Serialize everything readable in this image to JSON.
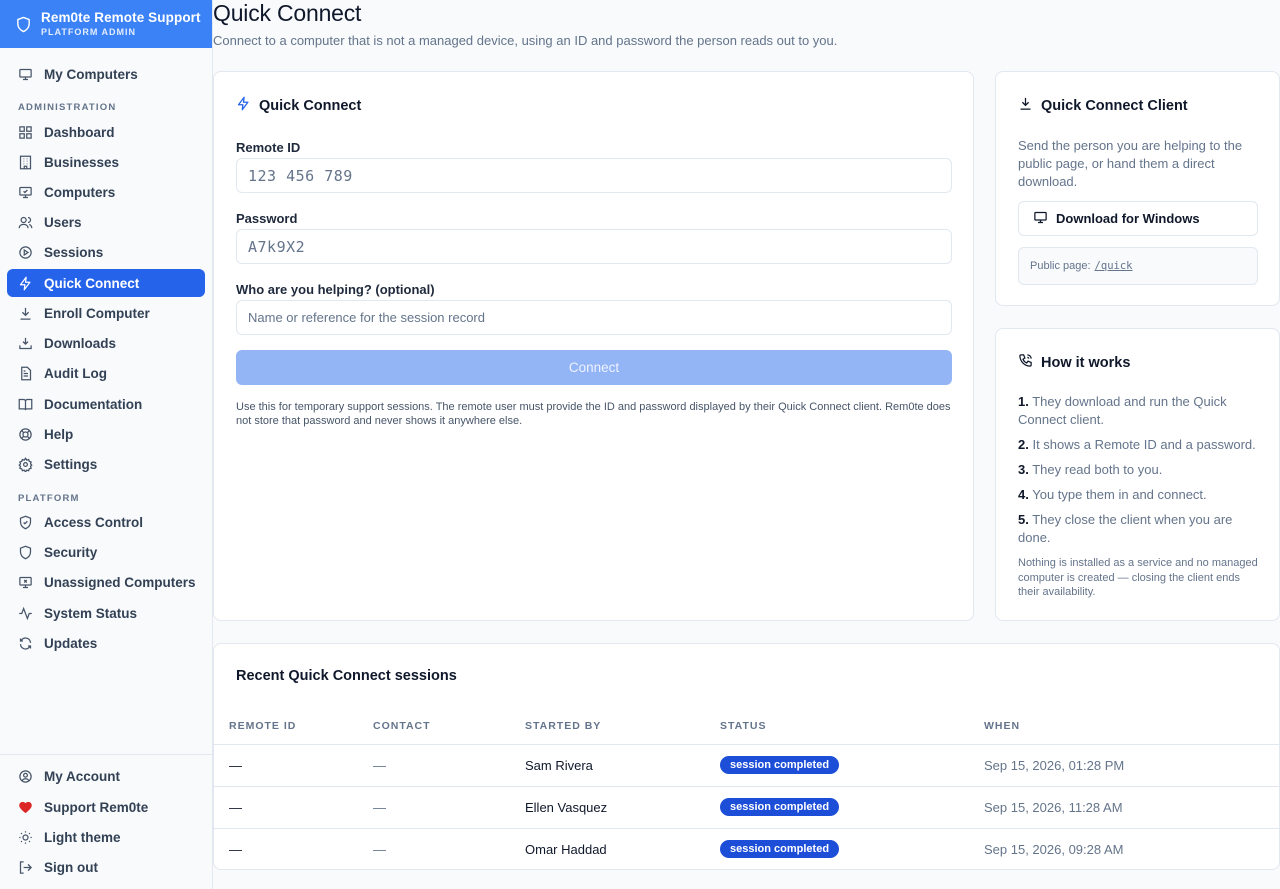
{
  "brand": {
    "title": "Rem0te Remote Support",
    "subtitle": "PLATFORM ADMIN"
  },
  "sidebar": {
    "top": [
      {
        "label": "My Computers",
        "icon": "monitor-icon"
      }
    ],
    "admin_label": "ADMINISTRATION",
    "admin": [
      {
        "label": "Dashboard",
        "icon": "grid-icon"
      },
      {
        "label": "Businesses",
        "icon": "building-icon"
      },
      {
        "label": "Computers",
        "icon": "computer-icon"
      },
      {
        "label": "Users",
        "icon": "users-icon"
      },
      {
        "label": "Sessions",
        "icon": "play-circle-icon"
      },
      {
        "label": "Quick Connect",
        "icon": "zap-icon",
        "active": true
      },
      {
        "label": "Enroll Computer",
        "icon": "download-icon"
      },
      {
        "label": "Downloads",
        "icon": "tray-download-icon"
      },
      {
        "label": "Audit Log",
        "icon": "file-text-icon"
      },
      {
        "label": "Documentation",
        "icon": "book-icon"
      },
      {
        "label": "Help",
        "icon": "lifebuoy-icon"
      },
      {
        "label": "Settings",
        "icon": "gear-icon"
      }
    ],
    "platform_label": "PLATFORM",
    "platform": [
      {
        "label": "Access Control",
        "icon": "shield-check-icon"
      },
      {
        "label": "Security",
        "icon": "shield-icon"
      },
      {
        "label": "Unassigned Computers",
        "icon": "monitor-x-icon"
      },
      {
        "label": "System Status",
        "icon": "activity-icon"
      },
      {
        "label": "Updates",
        "icon": "refresh-icon"
      }
    ],
    "bottom": [
      {
        "label": "My Account",
        "icon": "user-circle-icon"
      },
      {
        "label": "Support Rem0te",
        "icon": "heart-icon"
      },
      {
        "label": "Light theme",
        "icon": "sun-icon"
      },
      {
        "label": "Sign out",
        "icon": "log-out-icon"
      }
    ]
  },
  "page": {
    "title": "Quick Connect",
    "subtitle": "Connect to a computer that is not a managed device, using an ID and password the person reads out to you."
  },
  "form": {
    "title": "Quick Connect",
    "remote_id_label": "Remote ID",
    "remote_id_placeholder": "123 456 789",
    "password_label": "Password",
    "password_placeholder": "A7k9X2",
    "helping_label": "Who are you helping? (optional)",
    "helping_placeholder": "Name or reference for the session record",
    "connect_label": "Connect",
    "help_text": "Use this for temporary support sessions. The remote user must provide the ID and password displayed by their Quick Connect client. Rem0te does not store that password and never shows it anywhere else."
  },
  "client": {
    "title": "Quick Connect Client",
    "text": "Send the person you are helping to the public page, or hand them a direct download.",
    "download_label": "Download for Windows",
    "public_label": "Public page:",
    "public_link": "/quick"
  },
  "how": {
    "title": "How it works",
    "steps": [
      {
        "num": "1.",
        "text": "They download and run the Quick Connect client."
      },
      {
        "num": "2.",
        "text": "It shows a Remote ID and a password."
      },
      {
        "num": "3.",
        "text": "They read both to you."
      },
      {
        "num": "4.",
        "text": "You type them in and connect."
      },
      {
        "num": "5.",
        "text": "They close the client when you are done."
      }
    ],
    "note": "Nothing is installed as a service and no managed computer is created — closing the client ends their availability."
  },
  "recent": {
    "title": "Recent Quick Connect sessions",
    "columns": [
      "REMOTE ID",
      "CONTACT",
      "STARTED BY",
      "STATUS",
      "WHEN"
    ],
    "rows": [
      {
        "remote_id": "—",
        "contact": "—",
        "started_by": "Sam Rivera",
        "status": "session completed",
        "when": "Sep 15, 2026, 01:28 PM"
      },
      {
        "remote_id": "—",
        "contact": "—",
        "started_by": "Ellen Vasquez",
        "status": "session completed",
        "when": "Sep 15, 2026, 11:28 AM"
      },
      {
        "remote_id": "—",
        "contact": "—",
        "started_by": "Omar Haddad",
        "status": "session completed",
        "when": "Sep 15, 2026, 09:28 AM"
      }
    ]
  },
  "colors": {
    "accent": "#2563eb",
    "brand": "#3b82f6",
    "badge": "#1d4ed8",
    "heart": "#dc2626"
  }
}
